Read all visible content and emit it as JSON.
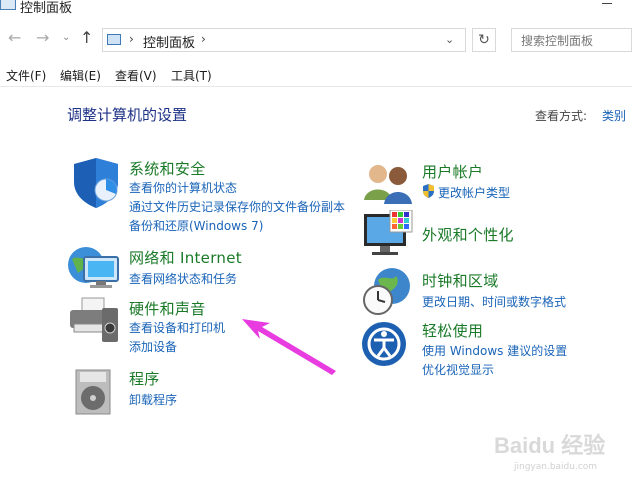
{
  "window": {
    "title": "控制面板"
  },
  "address": {
    "crumb": "控制面板",
    "separator": "›",
    "search_placeholder": "搜索控制面板"
  },
  "menu": [
    "文件(F)",
    "编辑(E)",
    "查看(V)",
    "工具(T)"
  ],
  "main": {
    "heading": "调整计算机的设置",
    "view_by_label": "查看方式:",
    "view_by_value": "类别"
  },
  "categories": [
    {
      "title": "系统和安全",
      "links": [
        "查看你的计算机状态",
        "通过文件历史记录保存你的文件备份副本",
        "备份和还原(Windows 7)"
      ]
    },
    {
      "title": "网络和 Internet",
      "links": [
        "查看网络状态和任务"
      ]
    },
    {
      "title": "硬件和声音",
      "links": [
        "查看设备和打印机",
        "添加设备"
      ]
    },
    {
      "title": "程序",
      "links": [
        "卸载程序"
      ]
    },
    {
      "title": "用户帐户",
      "links": [
        "更改帐户类型"
      ]
    },
    {
      "title": "外观和个性化",
      "links": []
    },
    {
      "title": "时钟和区域",
      "links": [
        "更改日期、时间或数字格式"
      ]
    },
    {
      "title": "轻松使用",
      "links": [
        "使用 Windows 建议的设置",
        "优化视觉显示"
      ]
    }
  ],
  "watermark": {
    "brand": "Baidu 经验",
    "url": "jingyan.baidu.com"
  },
  "colors": {
    "heading": "#1e3287",
    "category_title": "#1a7a28",
    "link": "#1a64b8",
    "annotation_arrow": "#e83ce0"
  },
  "icons": {
    "title": "control-panel-icon",
    "back": "back-arrow-icon",
    "forward": "forward-arrow-icon",
    "up": "up-arrow-icon",
    "refresh": "refresh-icon",
    "system_security": "shield-icon",
    "network": "globe-network-icon",
    "hardware": "printer-icon",
    "programs": "programs-disc-icon",
    "user_accounts": "users-icon",
    "appearance": "monitor-icon",
    "clock": "clock-globe-icon",
    "ease_of_access": "accessibility-icon"
  }
}
